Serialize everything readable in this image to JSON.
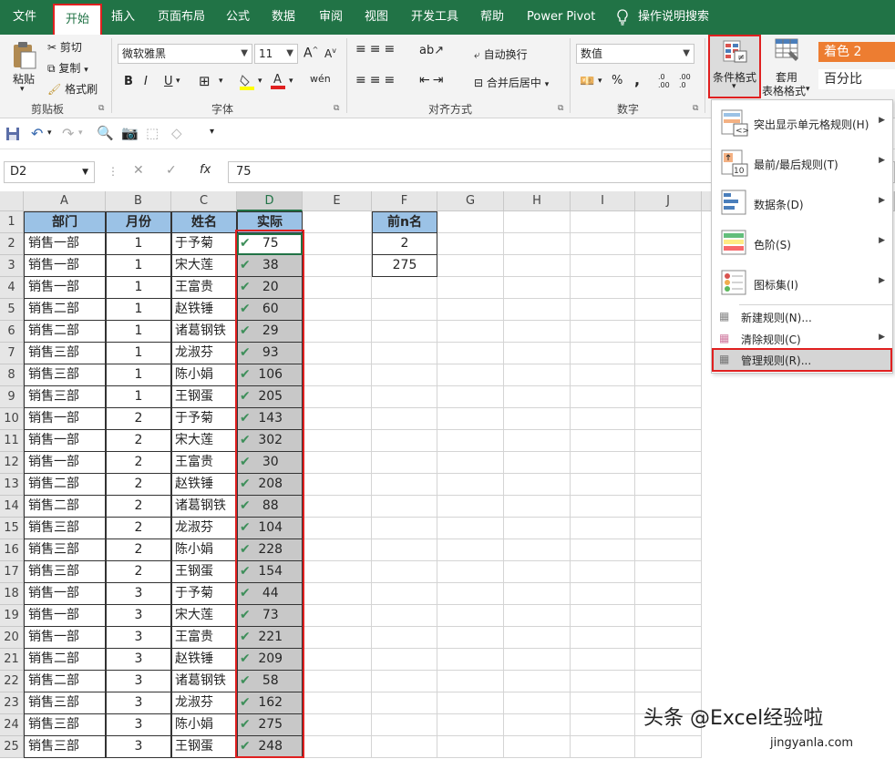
{
  "tabs": [
    "文件",
    "开始",
    "插入",
    "页面布局",
    "公式",
    "数据",
    "审阅",
    "视图",
    "开发工具",
    "帮助",
    "Power Pivot",
    "操作说明搜索"
  ],
  "ribbon": {
    "paste": "粘贴",
    "cut": "剪切",
    "copy": "复制",
    "format_painter": "格式刷",
    "clipboard_group": "剪贴板",
    "font_name": "微软雅黑",
    "font_size": "11",
    "font_group": "字体",
    "wrap_text": "自动换行",
    "merge_center": "合并后居中",
    "align_group": "对齐方式",
    "number_format": "数值",
    "number_group": "数字",
    "percent": "%",
    "comma": ",",
    "cond_format": "条件格式",
    "table_format_1": "套用",
    "table_format_2": "表格格式",
    "style_accent": "着色 2",
    "style_percent": "百分比",
    "bold": "B",
    "italic": "I",
    "underline": "U"
  },
  "formula_bar": {
    "name_box": "D2",
    "fx": "fx",
    "value": "75"
  },
  "columns": [
    "A",
    "B",
    "C",
    "D",
    "E",
    "F",
    "G",
    "H",
    "I",
    "J"
  ],
  "headers": {
    "dept": "部门",
    "month": "月份",
    "name": "姓名",
    "actual": "实际"
  },
  "topn": {
    "label": "前n名",
    "n": "2",
    "value": "275"
  },
  "rows": [
    [
      "销售一部",
      "1",
      "于予菊",
      "75"
    ],
    [
      "销售一部",
      "1",
      "宋大莲",
      "38"
    ],
    [
      "销售一部",
      "1",
      "王富贵",
      "20"
    ],
    [
      "销售二部",
      "1",
      "赵铁锤",
      "60"
    ],
    [
      "销售二部",
      "1",
      "诸葛钢铁",
      "29"
    ],
    [
      "销售三部",
      "1",
      "龙淑芬",
      "93"
    ],
    [
      "销售三部",
      "1",
      "陈小娟",
      "106"
    ],
    [
      "销售三部",
      "1",
      "王钢蛋",
      "205"
    ],
    [
      "销售一部",
      "2",
      "于予菊",
      "143"
    ],
    [
      "销售一部",
      "2",
      "宋大莲",
      "302"
    ],
    [
      "销售一部",
      "2",
      "王富贵",
      "30"
    ],
    [
      "销售二部",
      "2",
      "赵铁锤",
      "208"
    ],
    [
      "销售二部",
      "2",
      "诸葛钢铁",
      "88"
    ],
    [
      "销售三部",
      "2",
      "龙淑芬",
      "104"
    ],
    [
      "销售三部",
      "2",
      "陈小娟",
      "228"
    ],
    [
      "销售三部",
      "2",
      "王钢蛋",
      "154"
    ],
    [
      "销售一部",
      "3",
      "于予菊",
      "44"
    ],
    [
      "销售一部",
      "3",
      "宋大莲",
      "73"
    ],
    [
      "销售一部",
      "3",
      "王富贵",
      "221"
    ],
    [
      "销售二部",
      "3",
      "赵铁锤",
      "209"
    ],
    [
      "销售二部",
      "3",
      "诸葛钢铁",
      "58"
    ],
    [
      "销售三部",
      "3",
      "龙淑芬",
      "162"
    ],
    [
      "销售三部",
      "3",
      "陈小娟",
      "275"
    ],
    [
      "销售三部",
      "3",
      "王钢蛋",
      "248"
    ]
  ],
  "row_numbers": [
    "1",
    "2",
    "3",
    "4",
    "5",
    "6",
    "7",
    "8",
    "9",
    "10",
    "11",
    "12",
    "13",
    "14",
    "15",
    "16",
    "17",
    "18",
    "19",
    "20",
    "21",
    "22",
    "23",
    "24",
    "25"
  ],
  "menu": {
    "items": [
      "突出显示单元格规则(H)",
      "最前/最后规则(T)",
      "数据条(D)",
      "色阶(S)",
      "图标集(I)"
    ],
    "small_items": [
      "新建规则(N)...",
      "清除规则(C)",
      "管理规则(R)..."
    ]
  },
  "watermark": "头条 @Excel经验啦",
  "watermark_url": "jingyanla.com",
  "colors": {
    "excel_green": "#217346",
    "header_blue": "#9bc2e6",
    "highlight_red": "#e02020",
    "check_green": "#3e8f5a"
  }
}
